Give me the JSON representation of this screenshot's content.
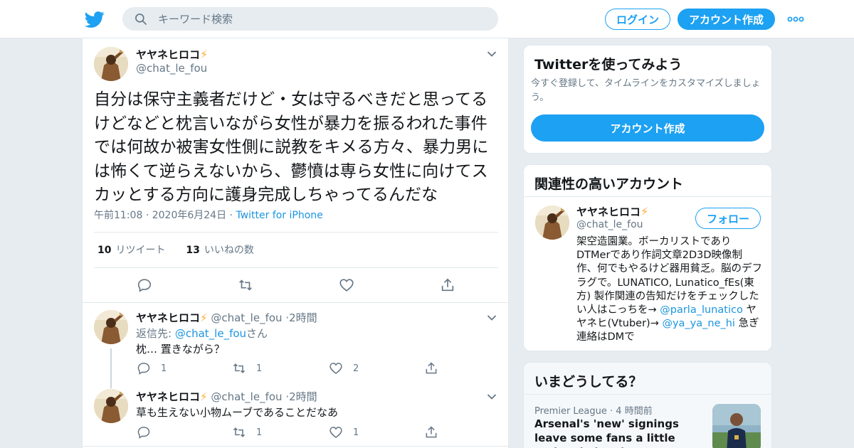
{
  "header": {
    "search_placeholder": "キーワード検索",
    "login_label": "ログイン",
    "signup_label": "アカウント作成"
  },
  "tweet": {
    "author_name": "ヤヤネヒロコ",
    "author_handle": "@chat_le_fou",
    "text": "自分は保守主義者だけど・女は守るべきだと思ってるけどなどと枕言いながら女性が暴力を振るわれた事件では何故か被害女性側に説教をキメる方々、暴力男には怖くて逆らえないから、鬱憤は専ら女性に向けてスカッとする方向に護身完成しちゃってるんだな",
    "time": "午前11:08",
    "date": "2020年6月24日",
    "source": "Twitter for iPhone",
    "retweets_count": "10",
    "retweets_label": "リツイート",
    "likes_count": "13",
    "likes_label": "いいねの数"
  },
  "replies": [
    {
      "author_name": "ヤヤネヒロコ",
      "author_handle": "@chat_le_fou",
      "time": "2時間",
      "reply_to_label": "返信先:",
      "reply_to_handle": "@chat_le_fou",
      "reply_to_suffix": "さん",
      "text": "枕… 置きながら？",
      "reply_count": "1",
      "retweet_count": "1",
      "like_count": "2"
    },
    {
      "author_name": "ヤヤネヒロコ",
      "author_handle": "@chat_le_fou",
      "time": "2時間",
      "text": "草も生えない小物ムーブであることだなあ",
      "reply_count": "",
      "retweet_count": "1",
      "like_count": "1"
    }
  ],
  "signup_card": {
    "title": "Twitterを使ってみよう",
    "subtitle": "今すぐ登録して、タイムラインをカスタマイズしましょう。",
    "button_label": "アカウント作成"
  },
  "related_card": {
    "title": "関連性の高いアカウント",
    "account_name": "ヤヤネヒロコ",
    "account_handle": "@chat_le_fou",
    "follow_label": "フォロー",
    "bio_1": "架空造園業。ボーカリストであり DTMerであり作詞文章2D3D映像制作、何でもやるけど器用貧乏。脳のデフラグで。LUNATICO, Lunatico_fEs(東方) 製作関連の告知だけをチェックしたい人はこっちを→ ",
    "bio_link_1": "@parla_lunatico",
    "bio_2": " ヤヤネヒ(Vtuber)→ ",
    "bio_link_2": "@ya_ya_ne_hi",
    "bio_3": " 急ぎ連絡はDMで"
  },
  "trends_card": {
    "title": "いまどうしてる？",
    "category": "Premier League",
    "time": "4 時間前",
    "headline": "Arsenal's 'new' signings leave some fans a little underwhelmed"
  },
  "colors": {
    "accent": "#1da1f2",
    "link": "#1b95e0",
    "background": "#e6ecf0",
    "muted_text": "#657786",
    "bolt": "#ffac33"
  },
  "icons": [
    "twitter-bird-icon",
    "search-icon",
    "more-dots-icon",
    "chevron-down-icon",
    "reply-icon",
    "retweet-icon",
    "like-icon",
    "share-icon",
    "lightning-emoji"
  ]
}
